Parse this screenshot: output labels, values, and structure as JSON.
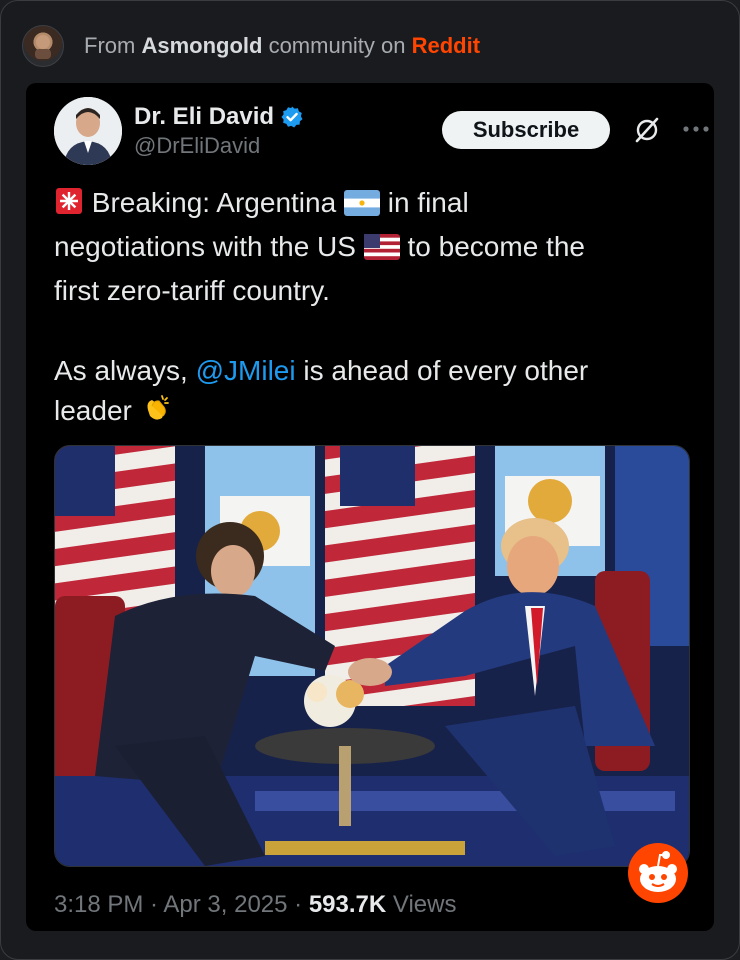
{
  "community": {
    "prefix": "From ",
    "name": "Asmongold",
    "middle": " community on ",
    "platform": "Reddit"
  },
  "tweet": {
    "display_name": "Dr. Eli David",
    "handle": "@DrEliDavid",
    "subscribe_label": "Subscribe",
    "line1_a": "Breaking: Argentina",
    "line1_b": "in final",
    "line2_a": "negotiations with the US",
    "line2_b": "to become the",
    "line3": "first zero-tariff country.",
    "line4_a": "As always, ",
    "mention": "@JMilei",
    "line4_b": " is ahead of every other",
    "line5": "leader",
    "time": "3:18 PM",
    "sep1": " · ",
    "date": "Apr 3, 2025",
    "sep2": " · ",
    "views_count": "593.7K",
    "views_label": " Views"
  },
  "colors": {
    "accent": "#1d9bf0",
    "reddit": "#ff4500",
    "background": "#000000"
  },
  "icons": [
    "verified-badge-icon",
    "grok-icon",
    "more-icon",
    "siren-emoji",
    "argentina-flag-emoji",
    "us-flag-emoji",
    "clapping-hands-emoji",
    "reddit-snoo-icon"
  ]
}
